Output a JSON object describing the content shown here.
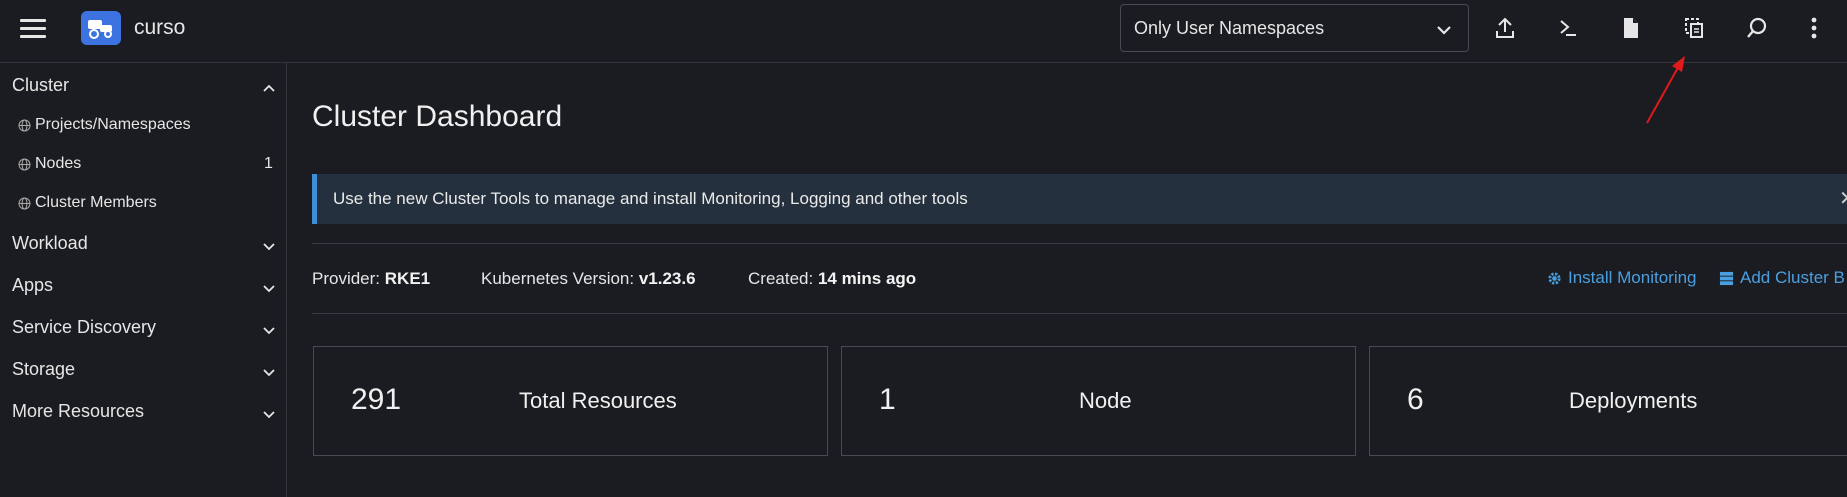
{
  "header": {
    "cluster_name": "curso",
    "namespace_filter": "Only User Namespaces",
    "icons": [
      "upload-icon",
      "shell-icon",
      "file-icon",
      "copy-kubeconfig-icon",
      "search-icon",
      "more-icon"
    ]
  },
  "sidebar": {
    "cluster_group": "Cluster",
    "cluster_items": [
      {
        "label": "Projects/Namespaces",
        "count": ""
      },
      {
        "label": "Nodes",
        "count": "1"
      },
      {
        "label": "Cluster Members",
        "count": ""
      }
    ],
    "groups": [
      "Workload",
      "Apps",
      "Service Discovery",
      "Storage",
      "More Resources"
    ]
  },
  "main": {
    "title": "Cluster Dashboard",
    "banner": "Use the new Cluster Tools to manage and install Monitoring, Logging and other tools",
    "provider_label": "Provider:",
    "provider_value": "RKE1",
    "k8s_label": "Kubernetes Version:",
    "k8s_value": "v1.23.6",
    "created_label": "Created:",
    "created_value": "14 mins ago",
    "install_monitoring": "Install Monitoring",
    "add_cluster_badge": "Add Cluster B",
    "cards": [
      {
        "value": "291",
        "label": "Total Resources"
      },
      {
        "value": "1",
        "label": "Node"
      },
      {
        "value": "6",
        "label": "Deployments"
      }
    ]
  },
  "colors": {
    "background": "#1b1c21",
    "accent": "#3d73e0",
    "link": "#4a9fe0",
    "banner": "#24303d",
    "annotation_arrow": "#e0191b"
  }
}
